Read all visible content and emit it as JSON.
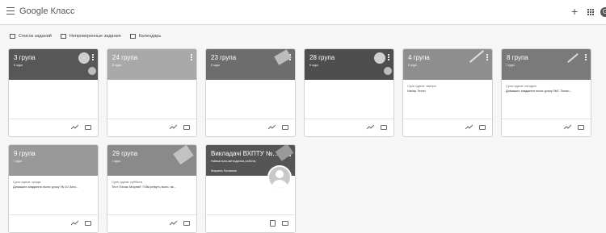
{
  "app": {
    "title": "Google Класс"
  },
  "subnav": {
    "todo": "Список заданий",
    "unchecked": "Непроверенные задания",
    "calendar": "Календарь"
  },
  "header": {
    "avatar_letter": "G"
  },
  "classes": [
    {
      "name": "3 група",
      "section": "II курс",
      "color": "#575757",
      "due": "",
      "task": "",
      "teacher": ""
    },
    {
      "name": "24 група",
      "section": "II курс",
      "color": "#a9a9a9",
      "due": "",
      "task": "",
      "teacher": ""
    },
    {
      "name": "23 група",
      "section": "II курс",
      "color": "#6d6d6d",
      "due": "",
      "task": "",
      "teacher": ""
    },
    {
      "name": "28 група",
      "section": "II курс",
      "color": "#4e4e4e",
      "due": "",
      "task": "",
      "teacher": ""
    },
    {
      "name": "4 група",
      "section": "II курс",
      "color": "#8e8e8e",
      "due": "Срок сдачи: завтра",
      "task": "Наліж Тести",
      "teacher": ""
    },
    {
      "name": "8 група",
      "section": "I курс",
      "color": "#7a7a7a",
      "due": "Срок сдачи: сегодня",
      "task": "Домашнє завдання після уроку №3 \"Загал...",
      "teacher": ""
    },
    {
      "name": "9 група",
      "section": "I курс",
      "color": "#999999",
      "due": "Срок сдачи: среда",
      "task": "Домашнє завдання після уроку № 10 Заго...",
      "teacher": ""
    },
    {
      "name": "29 група",
      "section": "I курс",
      "color": "#8a8a8a",
      "due": "Срок сдачи: суббота",
      "task": "Тест Панас Мирний \"Хіба ревуть воли, як...",
      "teacher": ""
    },
    {
      "name": "Викладачі ВХПТУ №...",
      "section": "Навчально-методична робота",
      "color": "#555555",
      "due": "",
      "task": "",
      "teacher": "Марина Лаланюк"
    }
  ]
}
